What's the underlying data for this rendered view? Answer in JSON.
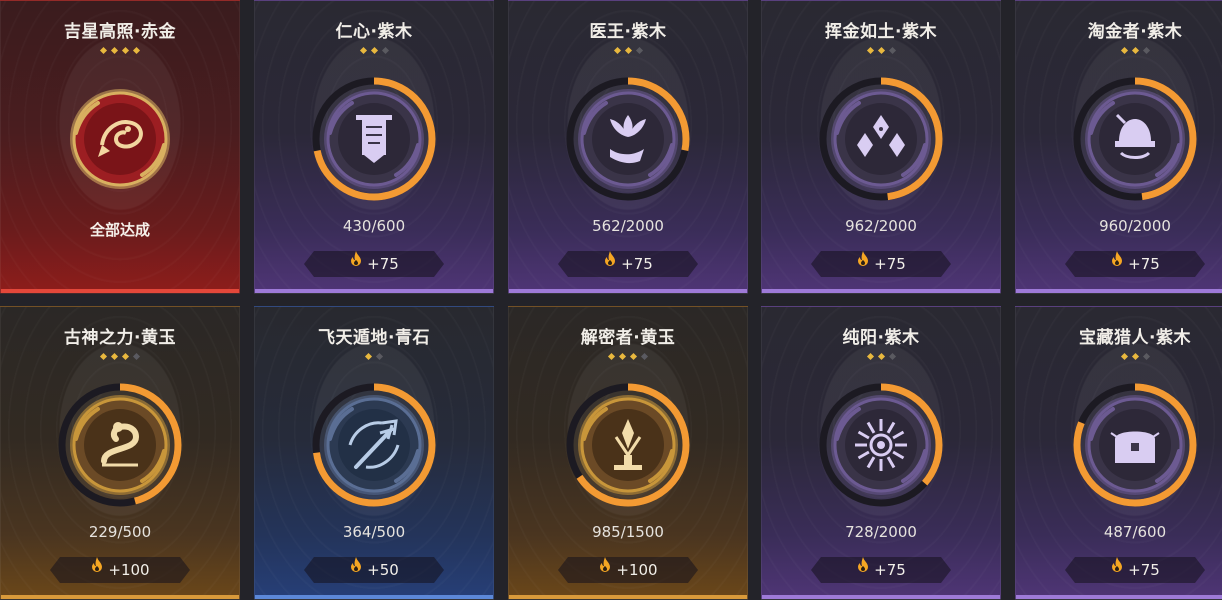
{
  "colors": {
    "ring_progress": "#f39a33",
    "ring_track": "#1c1a22",
    "star_on": "#e8b83e",
    "star_off": "#5a5a60",
    "reward_flame": "#f5a623"
  },
  "cards": [
    {
      "title": "吉星高照·赤金",
      "stars_on": 4,
      "stars_total": 4,
      "theme": "red",
      "icon": "koi-fish-icon",
      "complete": true,
      "complete_label": "全部达成",
      "progress": null,
      "progress_fraction": 1,
      "reward": null
    },
    {
      "title": "仁心·紫木",
      "stars_on": 2,
      "stars_total": 3,
      "theme": "purple",
      "icon": "banner-icon",
      "complete": false,
      "progress": "430/600",
      "progress_fraction": 0.717,
      "reward": "+75"
    },
    {
      "title": "医王·紫木",
      "stars_on": 2,
      "stars_total": 3,
      "theme": "purple",
      "icon": "lotus-hand-icon",
      "complete": false,
      "progress": "562/2000",
      "progress_fraction": 0.281,
      "reward": "+75"
    },
    {
      "title": "挥金如土·紫木",
      "stars_on": 2,
      "stars_total": 3,
      "theme": "purple",
      "icon": "diamond-gems-icon",
      "complete": false,
      "progress": "962/2000",
      "progress_fraction": 0.481,
      "reward": "+75"
    },
    {
      "title": "淘金者·紫木",
      "stars_on": 2,
      "stars_total": 3,
      "theme": "purple",
      "icon": "miner-helmet-icon",
      "complete": false,
      "progress": "960/2000",
      "progress_fraction": 0.48,
      "reward": "+75"
    },
    {
      "title": "古神之力·黄玉",
      "stars_on": 3,
      "stars_total": 4,
      "theme": "gold",
      "icon": "serpent-icon",
      "complete": false,
      "progress": "229/500",
      "progress_fraction": 0.458,
      "reward": "+100"
    },
    {
      "title": "飞天遁地·青石",
      "stars_on": 1,
      "stars_total": 2,
      "theme": "blue",
      "icon": "trident-icon",
      "complete": false,
      "progress": "364/500",
      "progress_fraction": 0.728,
      "reward": "+50"
    },
    {
      "title": "解密者·黄玉",
      "stars_on": 3,
      "stars_total": 4,
      "theme": "gold",
      "icon": "relic-icon",
      "complete": false,
      "progress": "985/1500",
      "progress_fraction": 0.657,
      "reward": "+100"
    },
    {
      "title": "纯阳·紫木",
      "stars_on": 2,
      "stars_total": 3,
      "theme": "purple",
      "icon": "sun-icon",
      "complete": false,
      "progress": "728/2000",
      "progress_fraction": 0.364,
      "reward": "+75"
    },
    {
      "title": "宝藏猎人·紫木",
      "stars_on": 2,
      "stars_total": 3,
      "theme": "purple",
      "icon": "treasure-chest-icon",
      "complete": false,
      "progress": "487/600",
      "progress_fraction": 0.812,
      "reward": "+75"
    }
  ]
}
